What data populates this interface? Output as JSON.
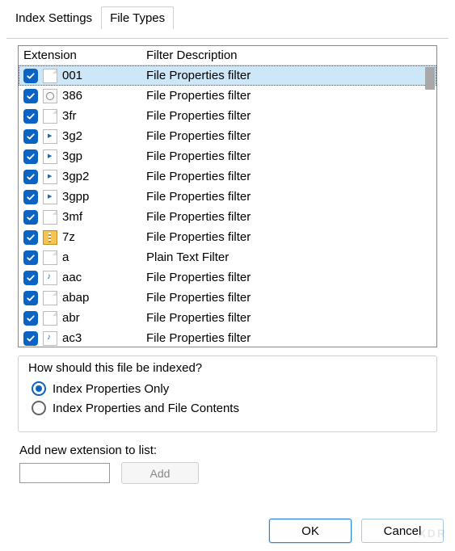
{
  "tabs": [
    {
      "label": "Index Settings",
      "active": false
    },
    {
      "label": "File Types",
      "active": true
    }
  ],
  "list": {
    "headers": {
      "extension": "Extension",
      "description": "Filter Description"
    },
    "rows": [
      {
        "checked": true,
        "icon": "page",
        "ext": "001",
        "desc": "File Properties filter",
        "selected": true
      },
      {
        "checked": true,
        "icon": "gear",
        "ext": "386",
        "desc": "File Properties filter",
        "selected": false
      },
      {
        "checked": true,
        "icon": "page",
        "ext": "3fr",
        "desc": "File Properties filter",
        "selected": false
      },
      {
        "checked": true,
        "icon": "video",
        "ext": "3g2",
        "desc": "File Properties filter",
        "selected": false
      },
      {
        "checked": true,
        "icon": "video",
        "ext": "3gp",
        "desc": "File Properties filter",
        "selected": false
      },
      {
        "checked": true,
        "icon": "video",
        "ext": "3gp2",
        "desc": "File Properties filter",
        "selected": false
      },
      {
        "checked": true,
        "icon": "video",
        "ext": "3gpp",
        "desc": "File Properties filter",
        "selected": false
      },
      {
        "checked": true,
        "icon": "page",
        "ext": "3mf",
        "desc": "File Properties filter",
        "selected": false
      },
      {
        "checked": true,
        "icon": "zip",
        "ext": "7z",
        "desc": "File Properties filter",
        "selected": false
      },
      {
        "checked": true,
        "icon": "page",
        "ext": "a",
        "desc": "Plain Text Filter",
        "selected": false
      },
      {
        "checked": true,
        "icon": "audio",
        "ext": "aac",
        "desc": "File Properties filter",
        "selected": false
      },
      {
        "checked": true,
        "icon": "page",
        "ext": "abap",
        "desc": "File Properties filter",
        "selected": false
      },
      {
        "checked": true,
        "icon": "page",
        "ext": "abr",
        "desc": "File Properties filter",
        "selected": false
      },
      {
        "checked": true,
        "icon": "audio",
        "ext": "ac3",
        "desc": "File Properties filter",
        "selected": false
      }
    ]
  },
  "index_group": {
    "label": "How should this file be indexed?",
    "options": [
      {
        "label": "Index Properties Only",
        "checked": true
      },
      {
        "label": "Index Properties and File Contents",
        "checked": false
      }
    ]
  },
  "add_extension": {
    "label": "Add new extension to list:",
    "value": "",
    "button": "Add"
  },
  "footer": {
    "ok": "OK",
    "cancel": "Cancel"
  },
  "watermark": "XDR"
}
